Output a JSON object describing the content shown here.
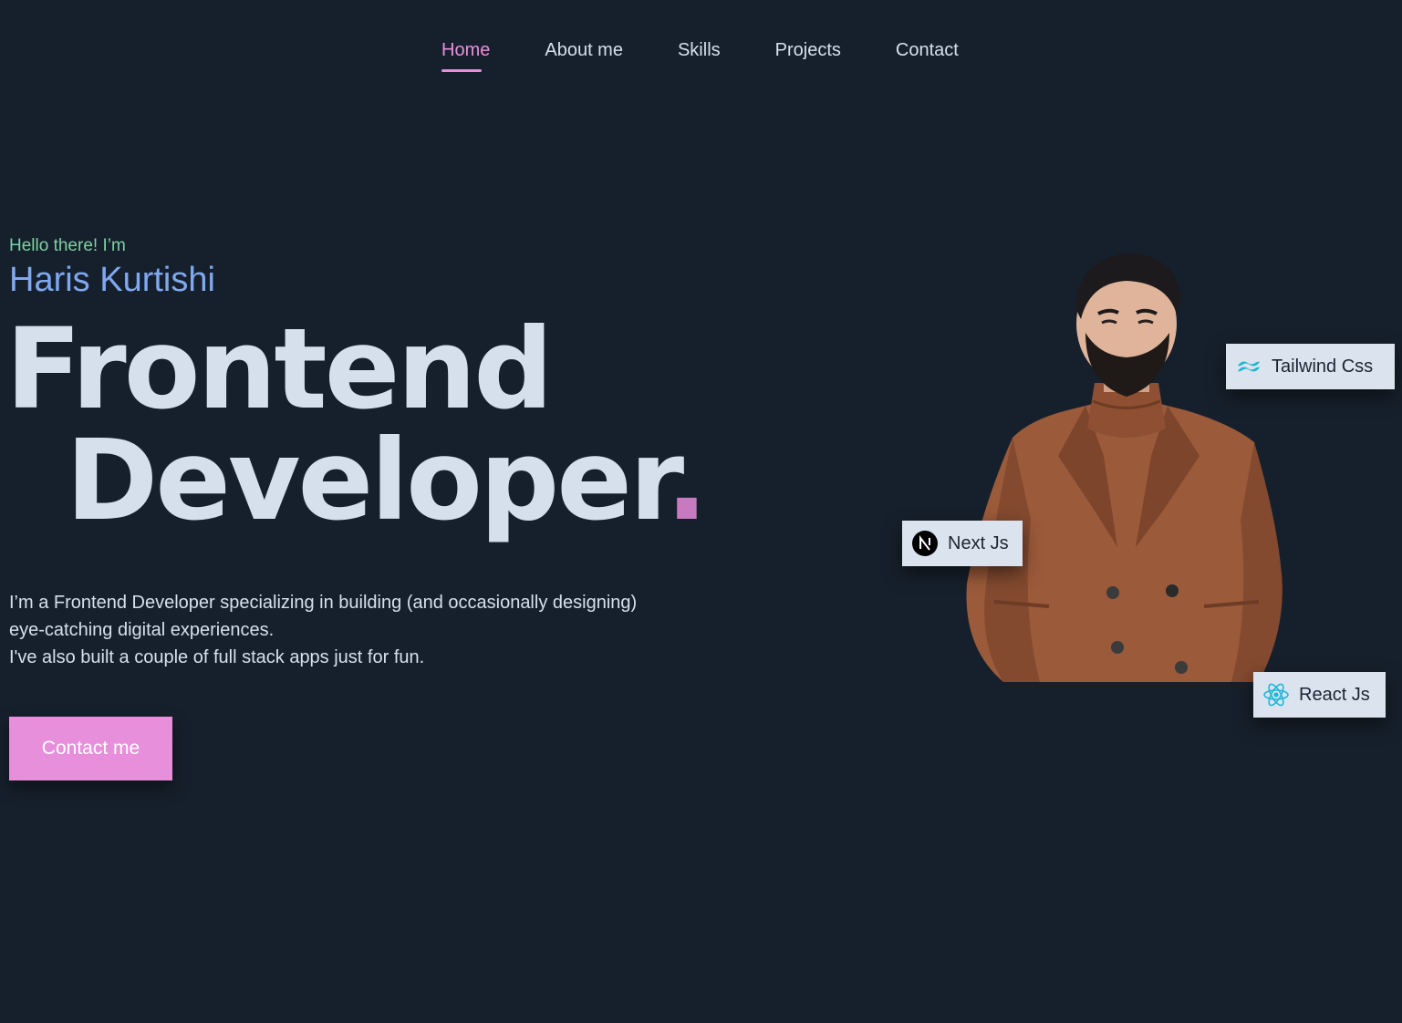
{
  "nav": {
    "items": [
      {
        "label": "Home",
        "active": true
      },
      {
        "label": "About me",
        "active": false
      },
      {
        "label": "Skills",
        "active": false
      },
      {
        "label": "Projects",
        "active": false
      },
      {
        "label": "Contact",
        "active": false
      }
    ]
  },
  "hero": {
    "greeting": "Hello there! I’m",
    "name": "Haris Kurtishi",
    "title_line1": "Frontend",
    "title_line2": "Developer",
    "title_dot": ".",
    "description_line1": "I’m a Frontend Developer specializing in building (and occasionally designing) eye-catching digital experiences.",
    "description_line2": "I've also built a couple of full stack apps just for fun.",
    "cta_label": "Contact me"
  },
  "badges": {
    "tailwind": {
      "label": "Tailwind Css",
      "icon": "tailwind-icon"
    },
    "next": {
      "label": "Next Js",
      "icon": "nextjs-icon"
    },
    "react": {
      "label": "React Js",
      "icon": "react-icon"
    }
  },
  "colors": {
    "background": "#16202c",
    "accent_pink": "#e88fdc",
    "name_blue": "#7fa8ef",
    "greeting_green": "#7fd0a3",
    "text": "#d6e0ec"
  }
}
